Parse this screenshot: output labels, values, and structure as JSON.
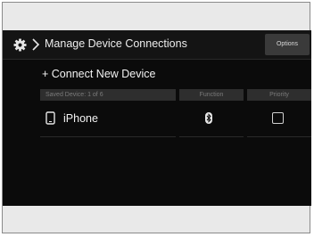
{
  "header": {
    "title": "Manage Device Connections",
    "options_label": "Options",
    "gear_icon": "gear-icon",
    "chevron_icon": "chevron-right-icon"
  },
  "connect_label": "+ Connect New Device",
  "table": {
    "headers": {
      "saved": "Saved Device: 1 of 6",
      "function": "Function",
      "priority": "Priority"
    },
    "rows": [
      {
        "name": "iPhone",
        "device_icon": "phone-icon",
        "function_icon": "bluetooth-icon",
        "priority_checked": false
      }
    ]
  },
  "colors": {
    "screen_bg": "#0b0b0b",
    "header_bg": "#141414",
    "column_header_bg": "#2e2e2e",
    "options_bg": "#3a3a3a",
    "text": "#f2f2f2"
  }
}
